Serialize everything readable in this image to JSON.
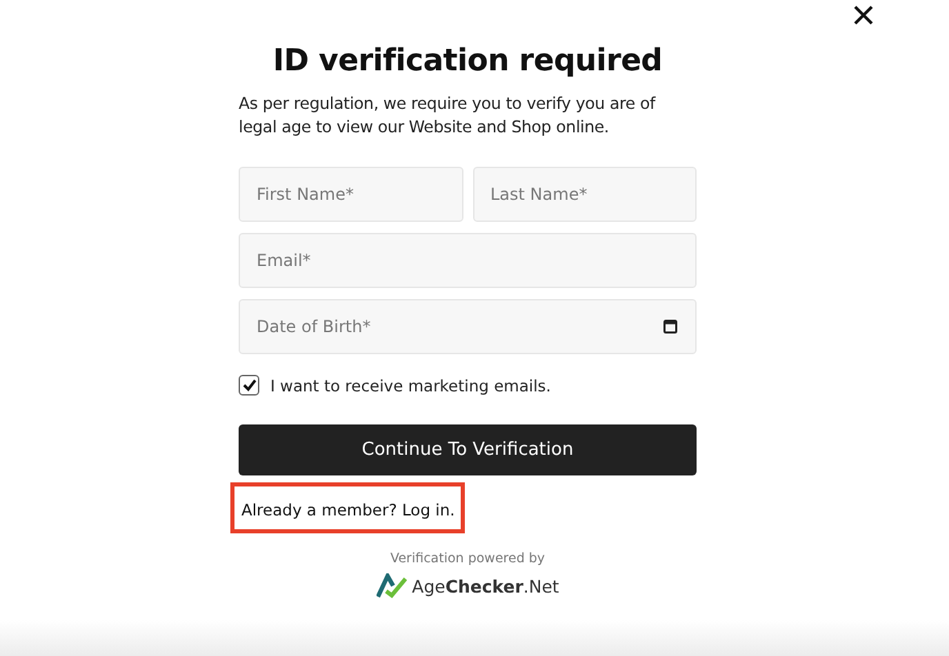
{
  "dialog": {
    "title": "ID verification required",
    "intro": "As per regulation, we require you to verify you are of legal age to view our Website and Shop online.",
    "fields": [
      {
        "kind": "text",
        "placeholder": "First Name*"
      },
      {
        "kind": "text",
        "placeholder": "Last Name*"
      },
      {
        "kind": "text",
        "placeholder": "Email*"
      },
      {
        "kind": "date",
        "placeholder": "Date of Birth*"
      }
    ],
    "consent": {
      "label": "I want to receive marketing emails.",
      "checked": true
    },
    "submit": "Continue To Verification",
    "login_link": {
      "text": "Already a member? Log in.",
      "highlighted": true
    },
    "footer": {
      "caption": "Verification powered by",
      "brand": "Age**Checker**.Net"
    }
  }
}
